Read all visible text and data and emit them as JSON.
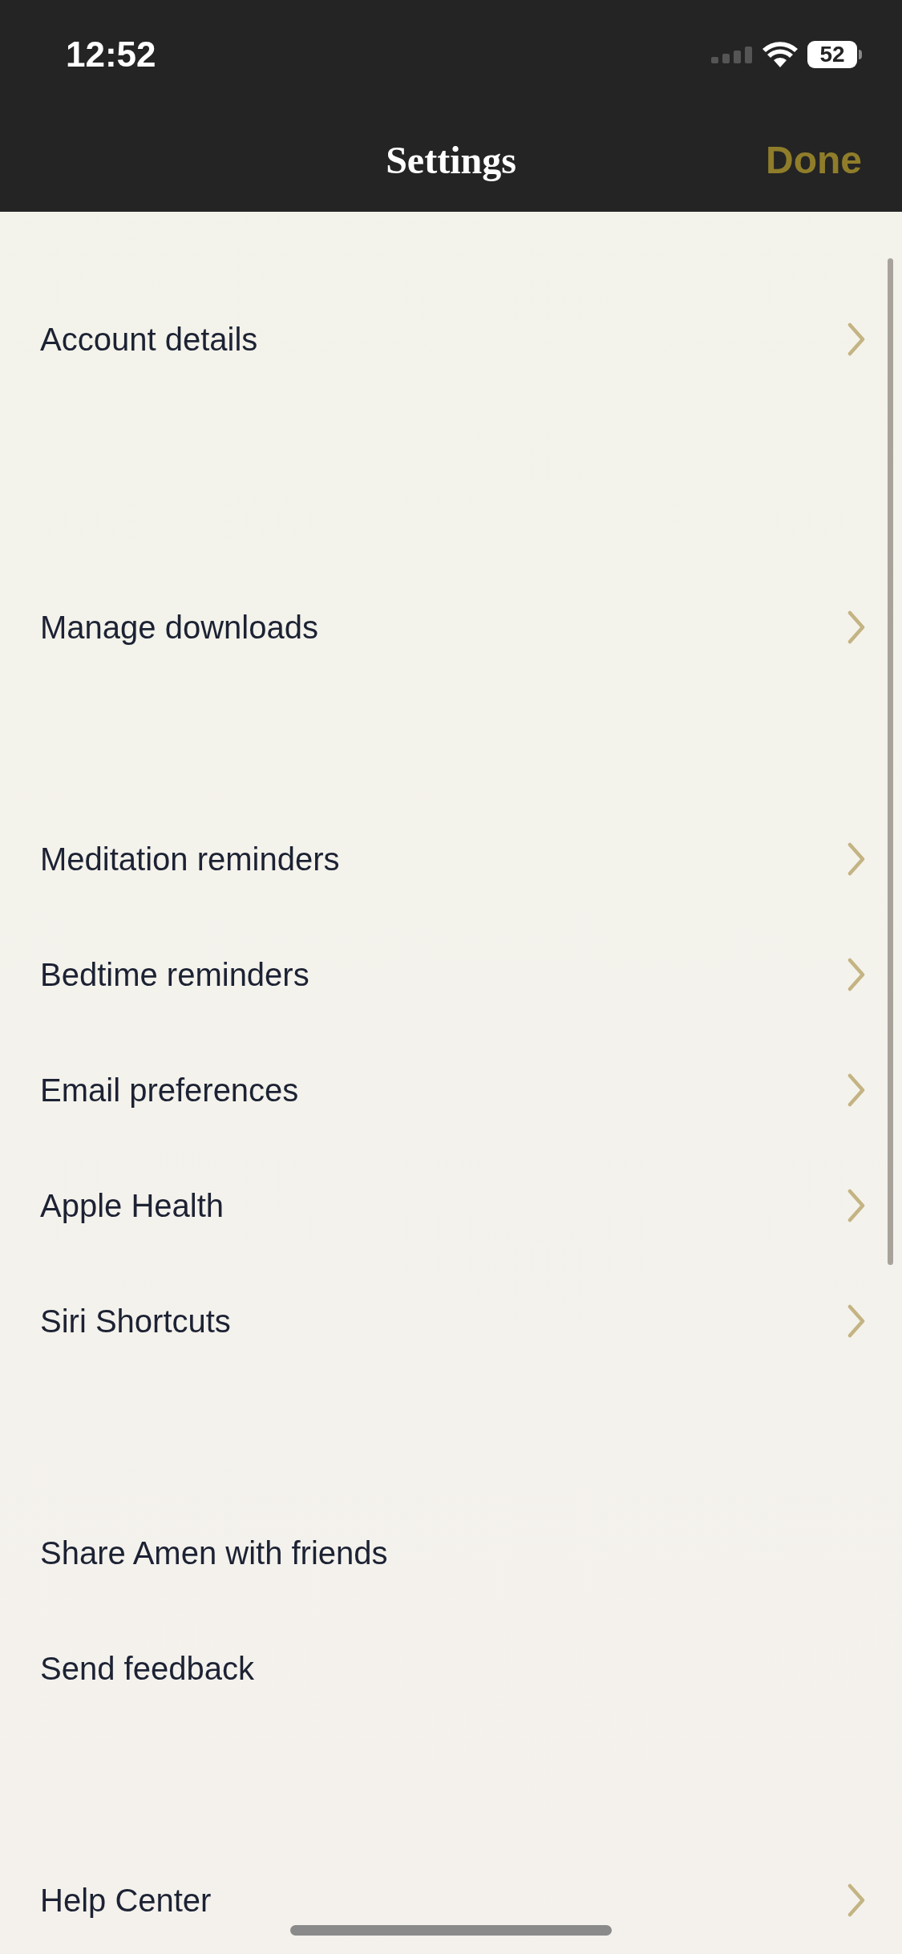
{
  "status_bar": {
    "time": "12:52",
    "battery": "52"
  },
  "nav_bar": {
    "title": "Settings",
    "done": "Done"
  },
  "sections": [
    {
      "items": [
        {
          "label": "Account details",
          "kind": "link"
        }
      ]
    },
    {
      "items": [
        {
          "label": "Manage downloads",
          "kind": "link"
        }
      ]
    },
    {
      "items": [
        {
          "label": "Meditation reminders",
          "kind": "link"
        },
        {
          "label": "Bedtime reminders",
          "kind": "link"
        },
        {
          "label": "Email preferences",
          "kind": "link"
        },
        {
          "label": "Apple Health",
          "kind": "link"
        },
        {
          "label": "Siri Shortcuts",
          "kind": "link"
        }
      ]
    },
    {
      "items": [
        {
          "label": "Share Amen with friends",
          "kind": "action"
        },
        {
          "label": "Send feedback",
          "kind": "action"
        }
      ]
    },
    {
      "items": [
        {
          "label": "Help Center",
          "kind": "link"
        }
      ]
    }
  ]
}
